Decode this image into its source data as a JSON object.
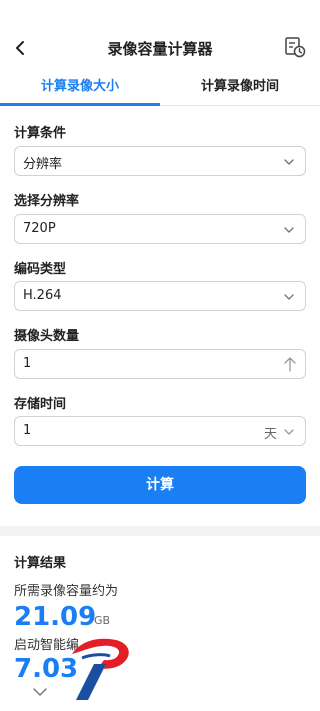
{
  "header": {
    "title": "录像容量计算器",
    "tabs": [
      {
        "label": "计算录像大小",
        "active": true
      },
      {
        "label": "计算录像时间",
        "active": false
      }
    ]
  },
  "form": {
    "condition": {
      "label": "计算条件",
      "value": "分辨率"
    },
    "resolution": {
      "label": "选择分辨率",
      "value": "720P"
    },
    "encoding": {
      "label": "编码类型",
      "value": "H.264"
    },
    "camera_count": {
      "label": "摄像头数量",
      "value": "1"
    },
    "storage_time": {
      "label": "存储时间",
      "value": "1",
      "unit": "天"
    },
    "calculate_label": "计算"
  },
  "results": {
    "title": "计算结果",
    "required_label": "所需录像容量约为",
    "required_value": "21.09",
    "required_unit": "GB",
    "smart_label": "启动智能编",
    "smart_value": "7.03"
  },
  "colors": {
    "accent": "#1a7ef5",
    "logo_red": "#e21f26",
    "logo_blue": "#1a4fa0"
  }
}
